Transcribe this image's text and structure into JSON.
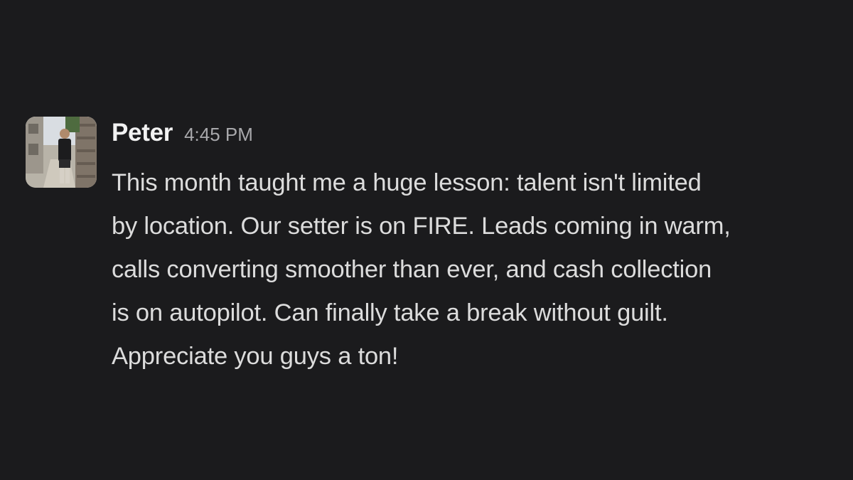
{
  "message": {
    "author": "Peter",
    "timestamp": "4:45 PM",
    "avatar_icon": "user-avatar-photo",
    "lines": [
      "This month taught me a huge lesson: talent isn't limited",
      "by location. Our setter is on FIRE. Leads coming in warm,",
      "calls converting smoother than ever, and cash collection",
      "is on autopilot. Can finally take a break without guilt.",
      "Appreciate you guys a ton!"
    ]
  },
  "colors": {
    "background": "#1b1b1d",
    "author_text": "#f2f2f2",
    "timestamp_text": "#a8a8ab",
    "message_text": "#dcdcdc"
  }
}
